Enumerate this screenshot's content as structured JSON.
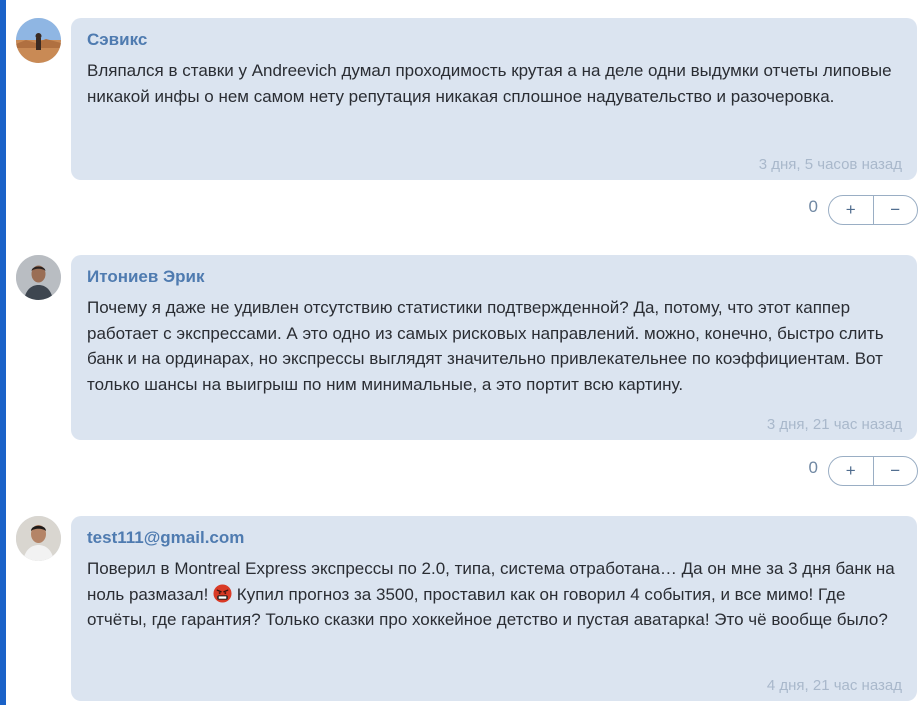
{
  "comments": [
    {
      "author": "Сэвикс",
      "text": "Вляпался в ставки у Andreevich думал проходимость крутая а на деле одни выдумки отчеты липовые никакой инфы о нем самом нету репутация никакая сплошное надувательство и разочеровка.",
      "timestamp": "3 дня, 5 часов назад",
      "votes": "0",
      "plus_label": "+",
      "minus_label": "−"
    },
    {
      "author": "Итониев Эрик",
      "text": "Почему я даже не удивлен отсутствию статистики подтвержденной? Да, потому, что этот каппер работает с экспрессами. А это одно из самых рисковых направлений. можно, конечно, быстро слить банк и на ординарах, но экспрессы выглядят значительно привлекательнее по коэффициентам. Вот только шансы на выигрыш по ним минимальные, а это портит всю картину.",
      "timestamp": "3 дня, 21 час назад",
      "votes": "0",
      "plus_label": "+",
      "minus_label": "−"
    },
    {
      "author": "test111@gmail.com",
      "text_before_emoji": "Поверил в Montreal Express экспрессы по 2.0, типа, система отработана… Да он мне за 3 дня банк на ноль размазал! ",
      "emoji": "angry-face-with-symbols",
      "text_after_emoji": " Купил прогноз за 3500, проставил как он говорил 4 события, и все мимо! Где отчёты, где гарантия? Только сказки про хоккейное детство и пустая аватарка! Это чё вообще было?",
      "timestamp": "4 дня, 21 час назад"
    }
  ],
  "colors": {
    "accent_bar": "#1a62c8",
    "bubble_bg": "#dbe4f0",
    "author": "#4f7bb0",
    "timestamp": "#a9b8cb"
  }
}
